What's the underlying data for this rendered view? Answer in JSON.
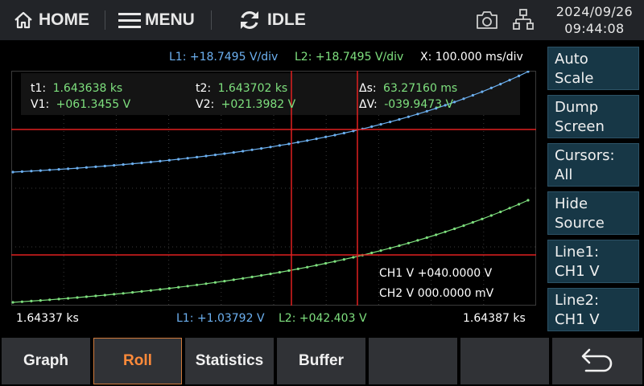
{
  "topbar": {
    "home": "HOME",
    "menu": "MENU",
    "state": "IDLE",
    "date": "2024/09/26",
    "time": "09:44:08"
  },
  "header": {
    "l1": "L1: +18.7495 V/div",
    "l2": "L2: +18.7495 V/div",
    "x": "X: 100.000 ms/div"
  },
  "cursors": {
    "t1_label": "t1:",
    "t1": "1.643638 ks",
    "v1_label": "V1:",
    "v1": "+061.3455 V",
    "t2_label": "t2:",
    "t2": "1.643702 ks",
    "v2_label": "V2:",
    "v2": "+021.3982 V",
    "ds_label": "Δs:",
    "ds": "63.27160 ms",
    "dv_label": "ΔV:",
    "dv": "-039.9473 V"
  },
  "channels": {
    "ch1": "CH1 V +040.0000 V",
    "ch2": "CH2 V 000.0000 mV"
  },
  "footer": {
    "left": "1.64337 ks",
    "l1": "L1: +1.03792 V",
    "l2": "L2: +042.403 V",
    "right": "1.64387 ks"
  },
  "side_buttons": [
    {
      "line1": "Auto",
      "line2": "Scale"
    },
    {
      "line1": "Dump",
      "line2": "Screen"
    },
    {
      "line1": "Cursors:",
      "line2": "All"
    },
    {
      "line1": "Hide",
      "line2": "Source"
    },
    {
      "line1": "Line1:",
      "line2": "CH1 V"
    },
    {
      "line1": "Line2:",
      "line2": "CH1 V"
    }
  ],
  "tabs": [
    {
      "label": "Graph",
      "selected": false
    },
    {
      "label": "Roll",
      "selected": true
    },
    {
      "label": "Statistics",
      "selected": false
    },
    {
      "label": "Buffer",
      "selected": false
    },
    {
      "label": "",
      "selected": false
    },
    {
      "label": "",
      "selected": false
    }
  ],
  "colors": {
    "line1": "#6cb0f0",
    "line2": "#7ee07e",
    "cursor": "#e02020",
    "side_button": "#173746",
    "tab_selected": "#ff8a3a"
  },
  "icons": {
    "home": "home-icon",
    "menu": "hamburger-icon",
    "state": "refresh-icon",
    "camera": "camera-icon",
    "network": "network-icon",
    "back": "back-arrow-icon"
  }
}
